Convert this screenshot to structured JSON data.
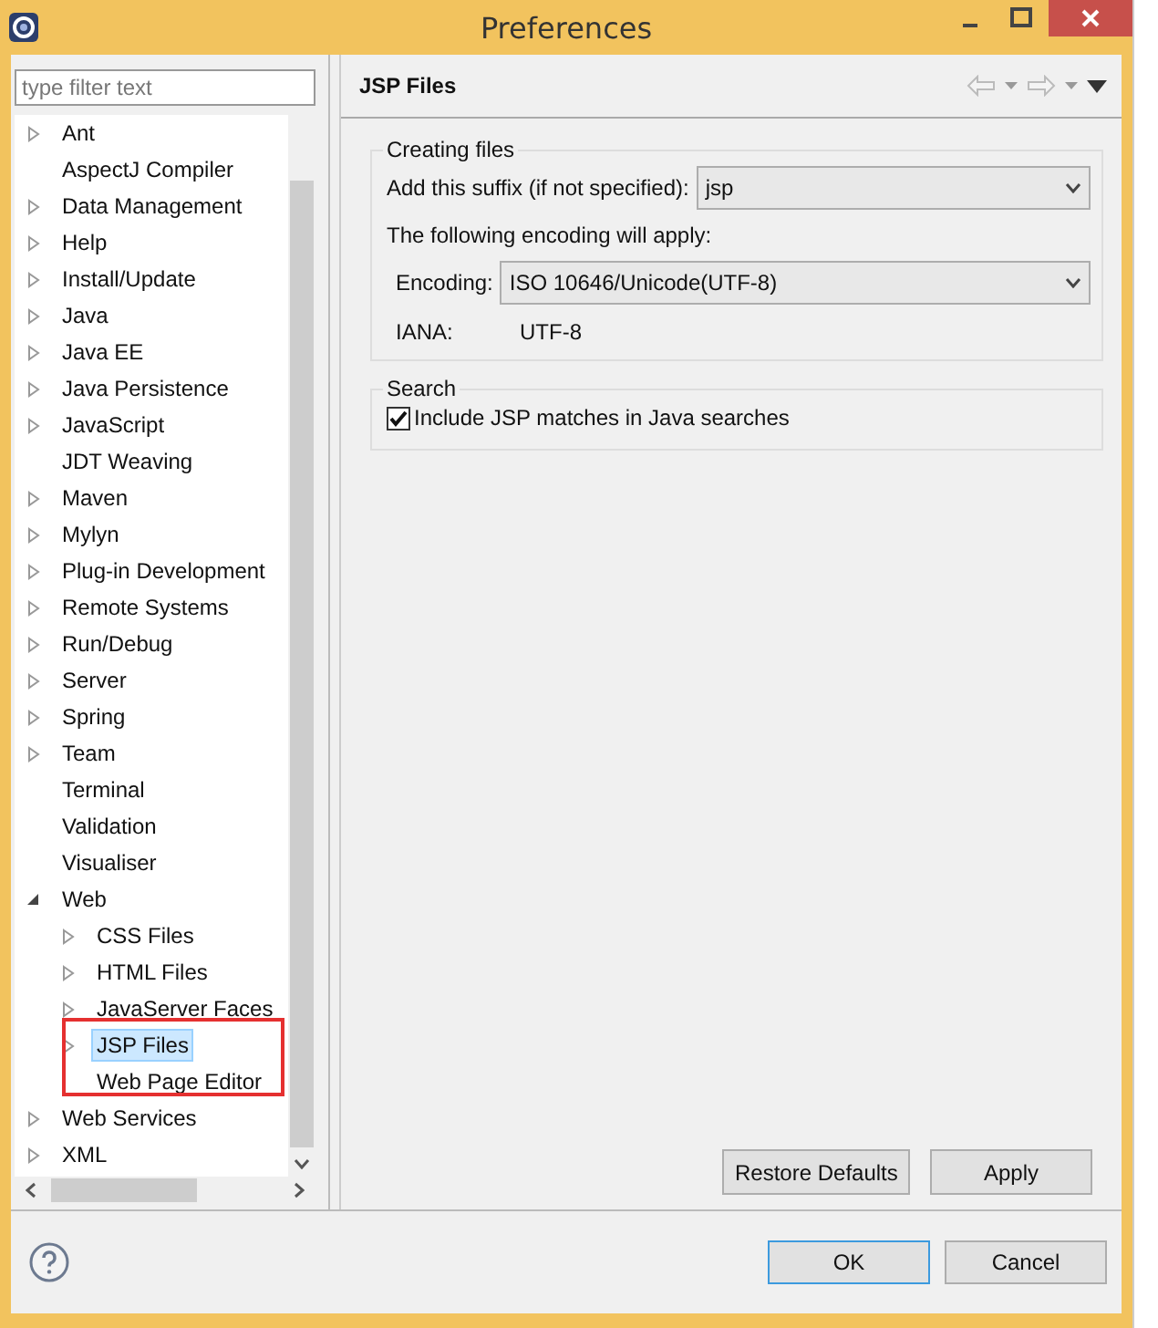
{
  "window": {
    "title": "Preferences"
  },
  "filter": {
    "placeholder": "type filter text"
  },
  "tree": [
    {
      "label": "Ant",
      "expanded": false,
      "selected": false
    },
    {
      "label": "AspectJ Compiler",
      "selected": false
    },
    {
      "label": "Data Management",
      "expanded": false,
      "selected": false
    },
    {
      "label": "Help",
      "expanded": false,
      "selected": false
    },
    {
      "label": "Install/Update",
      "expanded": false,
      "selected": false
    },
    {
      "label": "Java",
      "expanded": false,
      "selected": false
    },
    {
      "label": "Java EE",
      "expanded": false,
      "selected": false
    },
    {
      "label": "Java Persistence",
      "expanded": false,
      "selected": false
    },
    {
      "label": "JavaScript",
      "expanded": false,
      "selected": false
    },
    {
      "label": "JDT Weaving",
      "selected": false
    },
    {
      "label": "Maven",
      "expanded": false,
      "selected": false
    },
    {
      "label": "Mylyn",
      "expanded": false,
      "selected": false
    },
    {
      "label": "Plug-in Development",
      "expanded": false,
      "selected": false
    },
    {
      "label": "Remote Systems",
      "expanded": false,
      "selected": false
    },
    {
      "label": "Run/Debug",
      "expanded": false,
      "selected": false
    },
    {
      "label": "Server",
      "expanded": false,
      "selected": false
    },
    {
      "label": "Spring",
      "expanded": false,
      "selected": false
    },
    {
      "label": "Team",
      "expanded": false,
      "selected": false
    },
    {
      "label": "Terminal",
      "selected": false
    },
    {
      "label": "Validation",
      "selected": false
    },
    {
      "label": "Visualiser",
      "selected": false
    },
    {
      "label": "Web",
      "expanded": true,
      "selected": false,
      "children": [
        {
          "label": "CSS Files",
          "expanded": false,
          "selected": false
        },
        {
          "label": "HTML Files",
          "expanded": false,
          "selected": false
        },
        {
          "label": "JavaServer Faces",
          "expanded": false,
          "selected": false
        },
        {
          "label": "JSP Files",
          "expanded": false,
          "selected": true
        },
        {
          "label": "Web Page Editor",
          "selected": false
        }
      ]
    },
    {
      "label": "Web Services",
      "expanded": false,
      "selected": false
    },
    {
      "label": "XML",
      "expanded": false,
      "selected": false
    }
  ],
  "page": {
    "title": "JSP Files",
    "creating_group": {
      "title": "Creating files",
      "suffix_label": "Add this suffix (if not specified):",
      "suffix_value": "jsp",
      "encoding_note": "The following encoding will apply:",
      "encoding_label": "Encoding:",
      "encoding_value": "ISO 10646/Unicode(UTF-8)",
      "iana_label": "IANA:",
      "iana_value": "UTF-8"
    },
    "search_group": {
      "title": "Search",
      "checkbox_label": "Include JSP matches in Java searches",
      "checked": true
    },
    "buttons": [
      "Restore Defaults",
      "Apply"
    ]
  },
  "dialog_buttons": [
    "OK",
    "Cancel"
  ]
}
